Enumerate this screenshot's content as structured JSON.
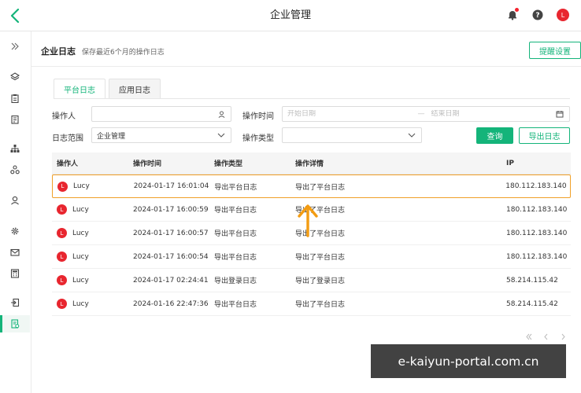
{
  "header": {
    "title": "企业管理",
    "avatar_letter": "L",
    "icons": [
      "back-chevron-icon",
      "bell-icon",
      "help-icon",
      "user-avatar"
    ]
  },
  "sidebar": {
    "icons": [
      "expand-chevrons-icon",
      "layers-icon",
      "clipboard-icon",
      "building-icon",
      "org-tree-icon",
      "cluster-icon",
      "user-icon",
      "settings-gear-icon",
      "mail-icon",
      "calculator-icon",
      "login-icon",
      "log-document-icon"
    ],
    "active_index": 11
  },
  "page": {
    "title": "企业日志",
    "subtitle": "保存最近6个月的操作日志",
    "remind_button": "提醒设置"
  },
  "tabs": [
    {
      "label": "平台日志",
      "active": true
    },
    {
      "label": "应用日志",
      "active": false
    }
  ],
  "filters": {
    "operator_label": "操作人",
    "operator_value": "",
    "time_label": "操作时间",
    "start_placeholder": "开始日期",
    "range_sep": "—",
    "end_placeholder": "结束日期",
    "scope_label": "日志范围",
    "scope_value": "企业管理",
    "type_label": "操作类型",
    "type_value": "",
    "query_button": "查询",
    "export_button": "导出日志"
  },
  "table": {
    "columns": [
      "操作人",
      "操作时间",
      "操作类型",
      "操作详情",
      "IP"
    ],
    "rows": [
      {
        "avatar": "L",
        "user": "Lucy",
        "time": "2024-01-17 16:01:04",
        "type": "导出平台日志",
        "detail": "导出了平台日志",
        "ip": "180.112.183.140"
      },
      {
        "avatar": "L",
        "user": "Lucy",
        "time": "2024-01-17 16:00:59",
        "type": "导出平台日志",
        "detail": "导出了平台日志",
        "ip": "180.112.183.140"
      },
      {
        "avatar": "L",
        "user": "Lucy",
        "time": "2024-01-17 16:00:57",
        "type": "导出平台日志",
        "detail": "导出了平台日志",
        "ip": "180.112.183.140"
      },
      {
        "avatar": "L",
        "user": "Lucy",
        "time": "2024-01-17 16:00:54",
        "type": "导出平台日志",
        "detail": "导出了平台日志",
        "ip": "180.112.183.140"
      },
      {
        "avatar": "L",
        "user": "Lucy",
        "time": "2024-01-17 02:24:41",
        "type": "导出登录日志",
        "detail": "导出了登录日志",
        "ip": "58.214.115.42"
      },
      {
        "avatar": "L",
        "user": "Lucy",
        "time": "2024-01-16 22:47:36",
        "type": "导出平台日志",
        "detail": "导出了平台日志",
        "ip": "58.214.115.42"
      }
    ],
    "highlight_row": 0
  },
  "pager": {
    "icons": [
      "first-page-icon",
      "prev-page-icon",
      "next-page-icon"
    ]
  },
  "colors": {
    "accent": "#14b47a",
    "highlight": "#f0a028",
    "avatar": "#e8262f"
  },
  "watermark": "e-kaiyun-portal.com.cn"
}
